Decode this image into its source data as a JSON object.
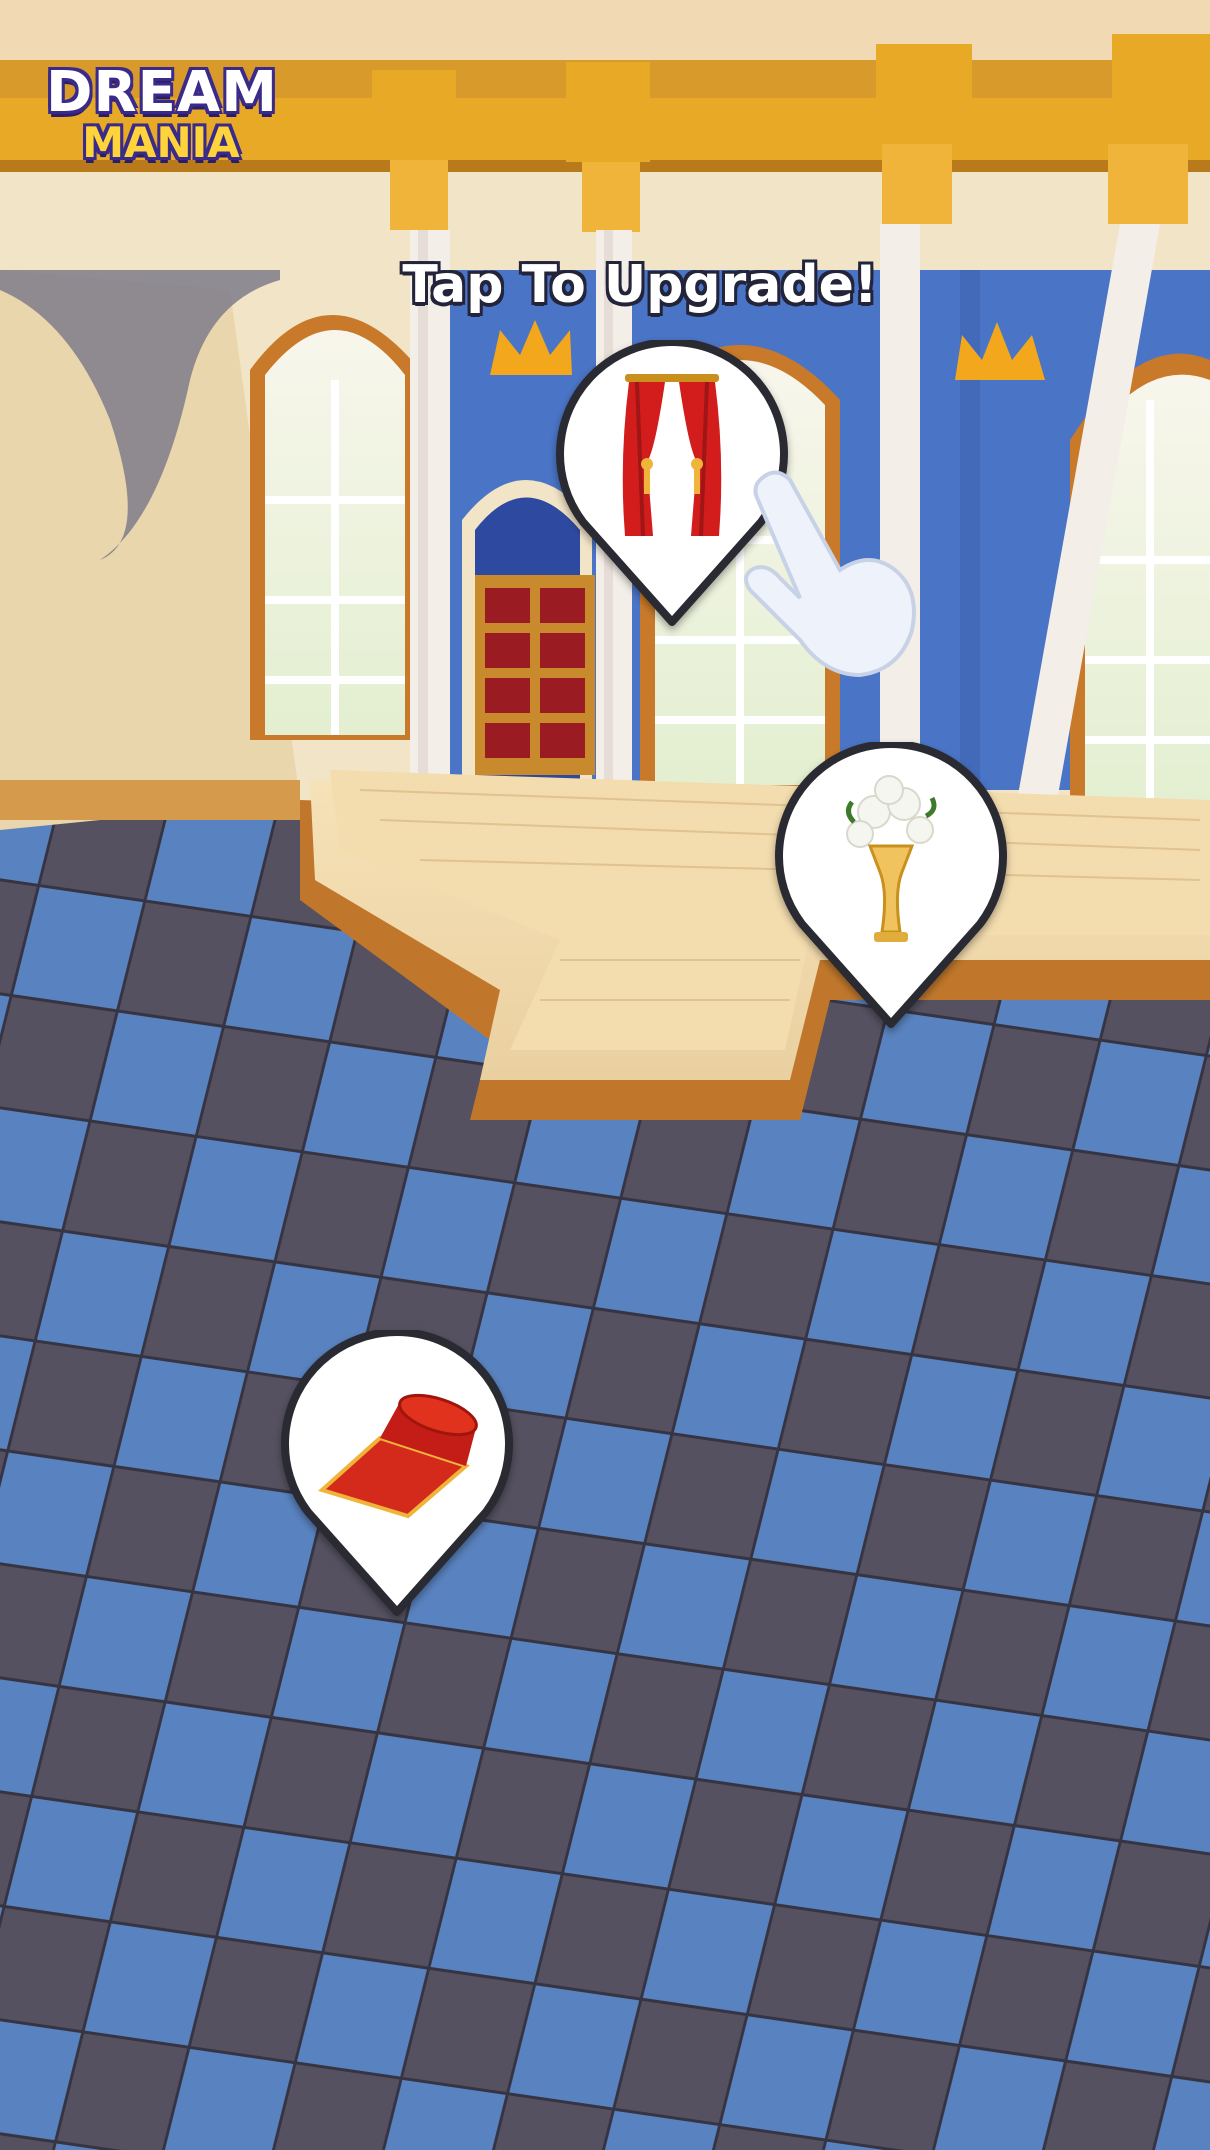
{
  "logo": {
    "line1": "DREAM",
    "line2": "MANIA"
  },
  "hint": {
    "text": "Tap To Upgrade!"
  },
  "pins": [
    {
      "item": "curtains-icon"
    },
    {
      "item": "flower-vase-icon"
    },
    {
      "item": "red-carpet-icon"
    }
  ],
  "colors": {
    "wall_blue": "#4a74c6",
    "wall_cream": "#f3e3c3",
    "gold_trim": "#e3a726",
    "floor_blue": "#5a86c4",
    "floor_dark": "#5a5664",
    "stage_wood": "#f0d8a8"
  }
}
